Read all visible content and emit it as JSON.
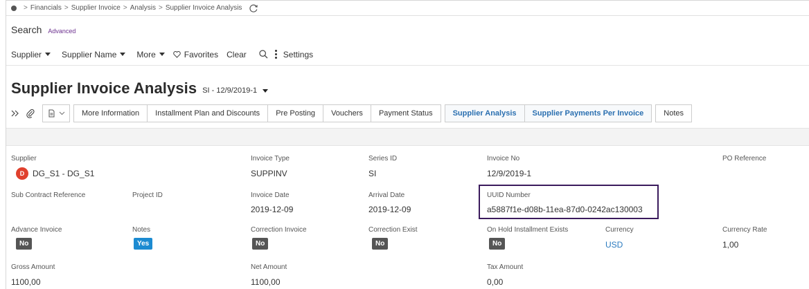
{
  "breadcrumb": {
    "items": [
      "Financials",
      "Supplier Invoice",
      "Analysis",
      "Supplier Invoice Analysis"
    ]
  },
  "search": {
    "label": "Search",
    "advanced": "Advanced"
  },
  "filters": {
    "supplier": "Supplier",
    "supplier_name": "Supplier Name",
    "more": "More",
    "favorites": "Favorites",
    "clear": "Clear",
    "settings": "Settings"
  },
  "page": {
    "title": "Supplier Invoice Analysis",
    "record": "SI - 12/9/2019-1"
  },
  "toolbar": {
    "buttons": [
      "More Information",
      "Installment Plan and Discounts",
      "Pre Posting",
      "Vouchers",
      "Payment Status"
    ],
    "active_buttons": [
      "Supplier Analysis",
      "Supplier Payments Per Invoice"
    ],
    "notes": "Notes"
  },
  "fields": {
    "supplier": {
      "label": "Supplier",
      "avatar": "D",
      "value": "DG_S1 - DG_S1"
    },
    "invoice_type": {
      "label": "Invoice Type",
      "value": "SUPPINV"
    },
    "series_id": {
      "label": "Series ID",
      "value": "SI"
    },
    "invoice_no": {
      "label": "Invoice No",
      "value": "12/9/2019-1"
    },
    "po_reference": {
      "label": "PO Reference",
      "value": ""
    },
    "sub_contract_reference": {
      "label": "Sub Contract Reference",
      "value": ""
    },
    "project_id": {
      "label": "Project ID",
      "value": ""
    },
    "invoice_date": {
      "label": "Invoice Date",
      "value": "2019-12-09"
    },
    "arrival_date": {
      "label": "Arrival Date",
      "value": "2019-12-09"
    },
    "uuid_number": {
      "label": "UUID Number",
      "value": "a5887f1e-d08b-11ea-87d0-0242ac130003"
    },
    "advance_invoice": {
      "label": "Advance Invoice",
      "value": "No"
    },
    "notes": {
      "label": "Notes",
      "value": "Yes"
    },
    "correction_invoice": {
      "label": "Correction Invoice",
      "value": "No"
    },
    "correction_exist": {
      "label": "Correction Exist",
      "value": "No"
    },
    "on_hold_installment_exists": {
      "label": "On Hold Installment Exists",
      "value": "No"
    },
    "currency": {
      "label": "Currency",
      "value": "USD"
    },
    "currency_rate": {
      "label": "Currency Rate",
      "value": "1,00"
    },
    "gross_amount": {
      "label": "Gross Amount",
      "value": "1100,00"
    },
    "net_amount": {
      "label": "Net Amount",
      "value": "1100,00"
    },
    "tax_amount": {
      "label": "Tax Amount",
      "value": "0,00"
    }
  },
  "colors": {
    "accent_purple": "#6b2f8e",
    "link_blue": "#2a7abf",
    "badge_yes": "#1c8bd1",
    "badge_no": "#555555",
    "avatar_red": "#e0402d",
    "highlight_border": "#3a1a5c"
  }
}
